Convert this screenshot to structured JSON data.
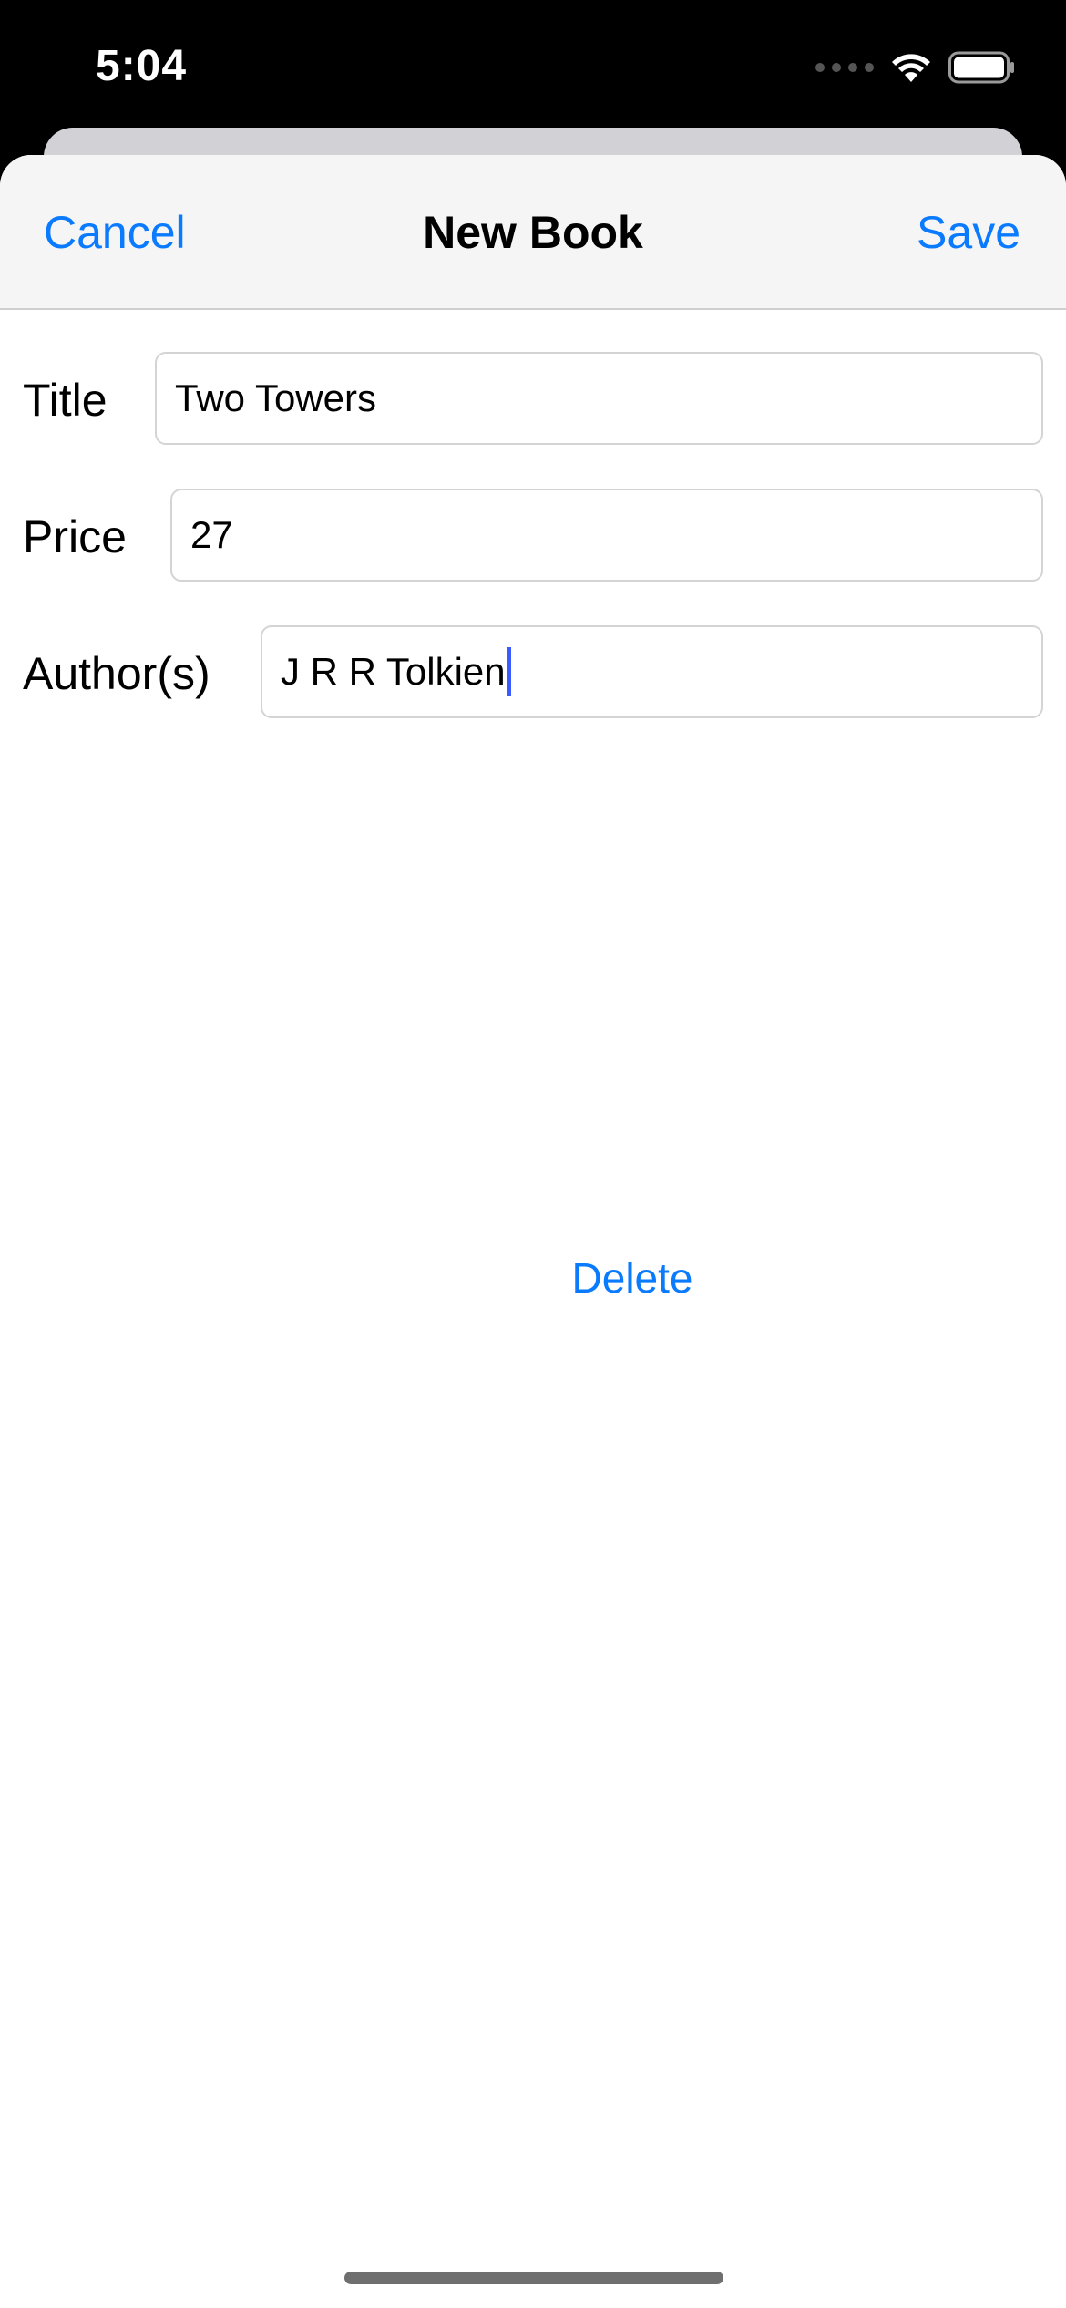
{
  "status_bar": {
    "time": "5:04",
    "icons": [
      "cellular-signal-icon",
      "wifi-icon",
      "battery-icon"
    ]
  },
  "nav": {
    "cancel_label": "Cancel",
    "title": "New Book",
    "save_label": "Save"
  },
  "form": {
    "fields": [
      {
        "label": "Title",
        "value": "Two Towers"
      },
      {
        "label": "Price",
        "value": "27"
      },
      {
        "label": "Author(s)",
        "value": "J R R Tolkien"
      }
    ]
  },
  "actions": {
    "delete_label": "Delete"
  },
  "colors": {
    "accent": "#0a7aff",
    "caret": "#3c5bff",
    "nav_background": "#f5f5f5"
  }
}
